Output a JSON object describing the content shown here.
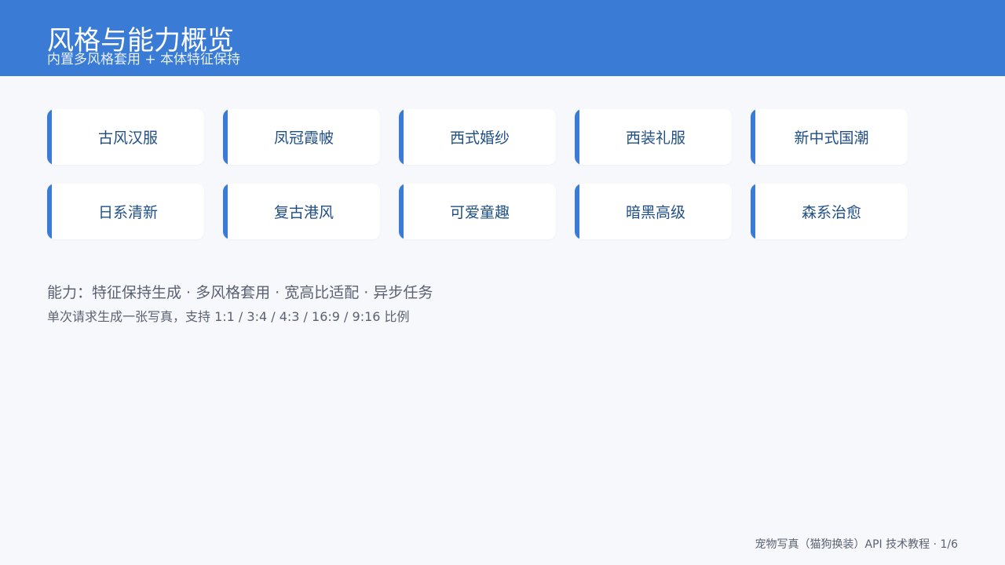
{
  "header": {
    "title": "风格与能力概览",
    "subtitle": "内置多风格套用 + 本体特征保持",
    "background_color": "#3a7bd5"
  },
  "styles": {
    "row1": [
      "古风汉服",
      "凤冠霞帔",
      "西式婚纱",
      "西装礼服",
      "新中式国潮"
    ],
    "row2": [
      "日系清新",
      "复古港风",
      "可爱童趣",
      "暗黑高级",
      "森系治愈"
    ]
  },
  "capabilities_text": "能力：特征保持生成 · 多风格套用 · 宽高比适配 · 异步任务",
  "note_text": "单次请求生成一张写真，支持 1:1 / 3:4 / 4:3 / 16:9 / 9:16 比例",
  "footer_text": "宠物写真（猫狗换装）API 技术教程 · 1/6",
  "colors": {
    "accent": "#3a7bd5",
    "card_text": "#1f4f86",
    "background": "#f6f8fc"
  }
}
